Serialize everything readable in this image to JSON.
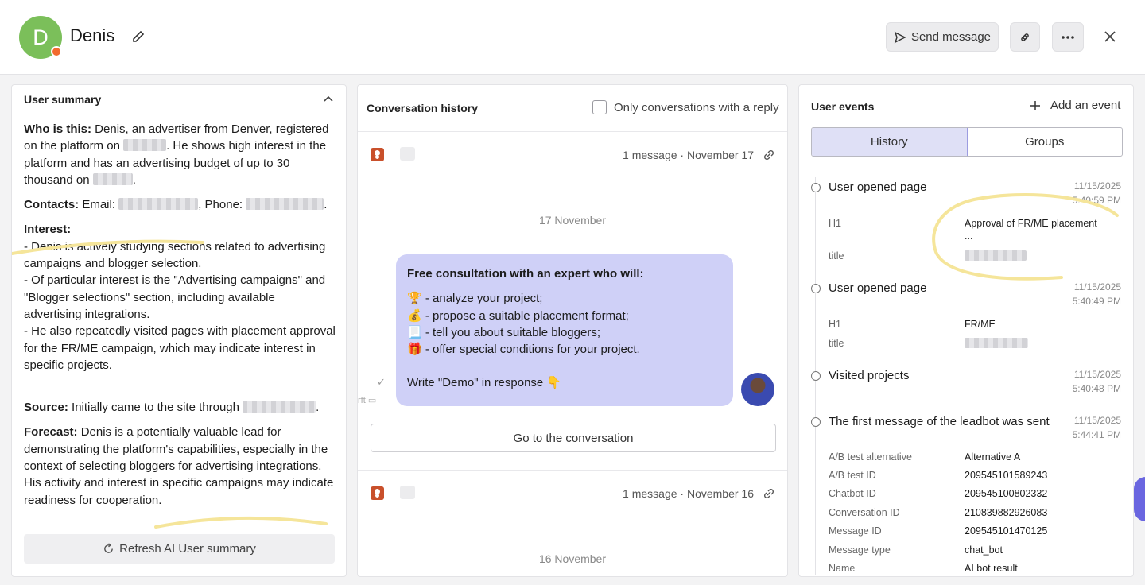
{
  "header": {
    "avatar_initial": "D",
    "user_name": "Denis",
    "send_message_label": "Send message"
  },
  "summary": {
    "title": "User summary",
    "who_label": "Who is this:",
    "who_text_1": "Denis, an advertiser from Denver, registered on the platform on",
    "who_text_2": ". He shows high interest in the platform and has an advertising budget of up to 30 thousand on",
    "who_text_3": ".",
    "contacts_label": "Contacts:",
    "contacts_email": "Email:",
    "contacts_phone": ", Phone:",
    "contacts_end": ".",
    "interest_label": "Interest:",
    "interest_1": "- Denis is actively studying sections related to advertising campaigns and blogger selection.",
    "interest_2": "- Of particular interest is the \"Advertising campaigns\" and \"Blogger selections\" section, including available advertising integrations.",
    "interest_3": "- He also repeatedly visited pages with placement approval for the FR/ME campaign, which may indicate interest in specific projects.",
    "source_label": "Source:",
    "source_text": "Initially came to the site through",
    "source_end": ".",
    "forecast_label": "Forecast:",
    "forecast_text": "Denis is a potentially valuable lead for demonstrating the platform's capabilities, especially in the context of selecting bloggers for advertising integrations. His activity and interest in specific campaigns may indicate readiness for cooperation.",
    "refresh_label": "Refresh AI User summary"
  },
  "conversation": {
    "title": "Conversation history",
    "filter_label": "Only conversations with a reply",
    "items": [
      {
        "meta": "1 message · November 17",
        "date": "17 November"
      },
      {
        "meta": "1 message · November 16",
        "date": "16 November"
      }
    ],
    "bubble": {
      "title": "Free consultation with an expert who will:",
      "line1": "🏆 - analyze your project;",
      "line2": "💰 - propose a suitable placement format;",
      "line3": "📃 - tell you about suitable bloggers;",
      "line4": "🎁 - offer special conditions for your project.",
      "line5": "Write \"Demo\" in response 👇"
    },
    "side_label": "rft",
    "go_label": "Go to the conversation"
  },
  "events": {
    "title": "User events",
    "add_label": "Add an event",
    "tabs": [
      "History",
      "Groups"
    ],
    "list": [
      {
        "name": "User opened page",
        "date": "11/15/2025",
        "time": "5:40:59 PM",
        "k1": "H1",
        "v1": "Approval of FR/ME placement",
        "v1b": "...",
        "k2": "title"
      },
      {
        "name": "User opened page",
        "date": "11/15/2025",
        "time": "5:40:49 PM",
        "k1": "H1",
        "v1": "FR/ME",
        "k2": "title"
      },
      {
        "name": "Visited projects",
        "date": "11/15/2025",
        "time": "5:40:48 PM"
      },
      {
        "name": "The first message of the leadbot was sent",
        "date": "11/15/2025",
        "time": "5:44:41 PM"
      }
    ],
    "details": [
      {
        "k": "A/B test alternative",
        "v": "Alternative A"
      },
      {
        "k": "A/B test ID",
        "v": "209545101589243"
      },
      {
        "k": "Chatbot ID",
        "v": "209545100802332"
      },
      {
        "k": "Conversation ID",
        "v": "210839882926083"
      },
      {
        "k": "Message ID",
        "v": "209545101470125"
      },
      {
        "k": "Message type",
        "v": "chat_bot"
      },
      {
        "k": "Name",
        "v": "AI bot result"
      }
    ]
  },
  "colors": {
    "avatar": "#7bbf5a",
    "accent_purple": "#cfd0f7",
    "highlight_yellow": "#f5e59a"
  }
}
